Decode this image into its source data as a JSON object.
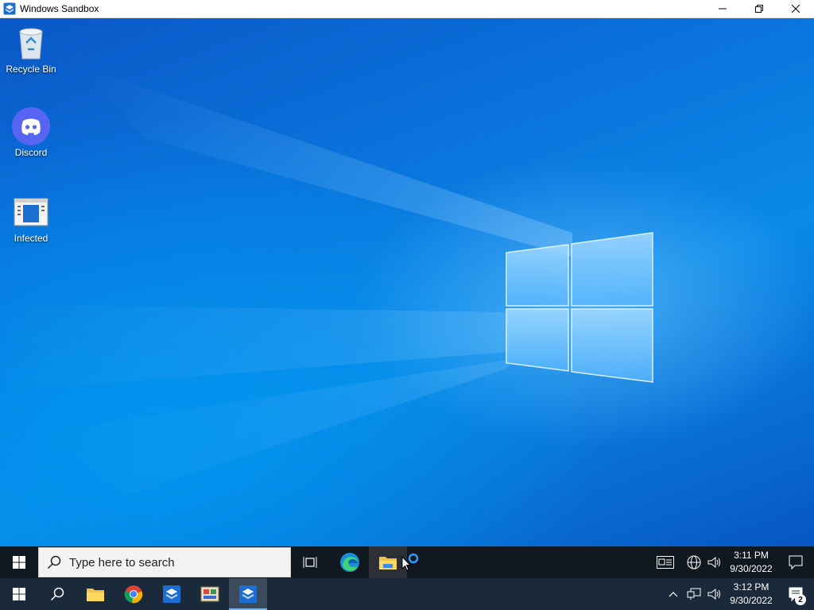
{
  "window": {
    "title": "Windows Sandbox"
  },
  "desktop": {
    "icons": [
      {
        "label": "Recycle Bin",
        "icon": "recycle-bin-icon"
      },
      {
        "label": "Discord",
        "icon": "discord-icon"
      },
      {
        "label": "Infected",
        "icon": "application-icon"
      }
    ]
  },
  "inner_taskbar": {
    "search_placeholder": "Type here to search",
    "clock_time": "3:11 PM",
    "clock_date": "9/30/2022"
  },
  "outer_taskbar": {
    "clock_time": "3:12 PM",
    "clock_date": "9/30/2022",
    "notification_count": "2"
  },
  "colors": {
    "accent": "#0a74dc",
    "taskbar_inner": "#101820",
    "taskbar_outer": "#1b2a3a"
  }
}
